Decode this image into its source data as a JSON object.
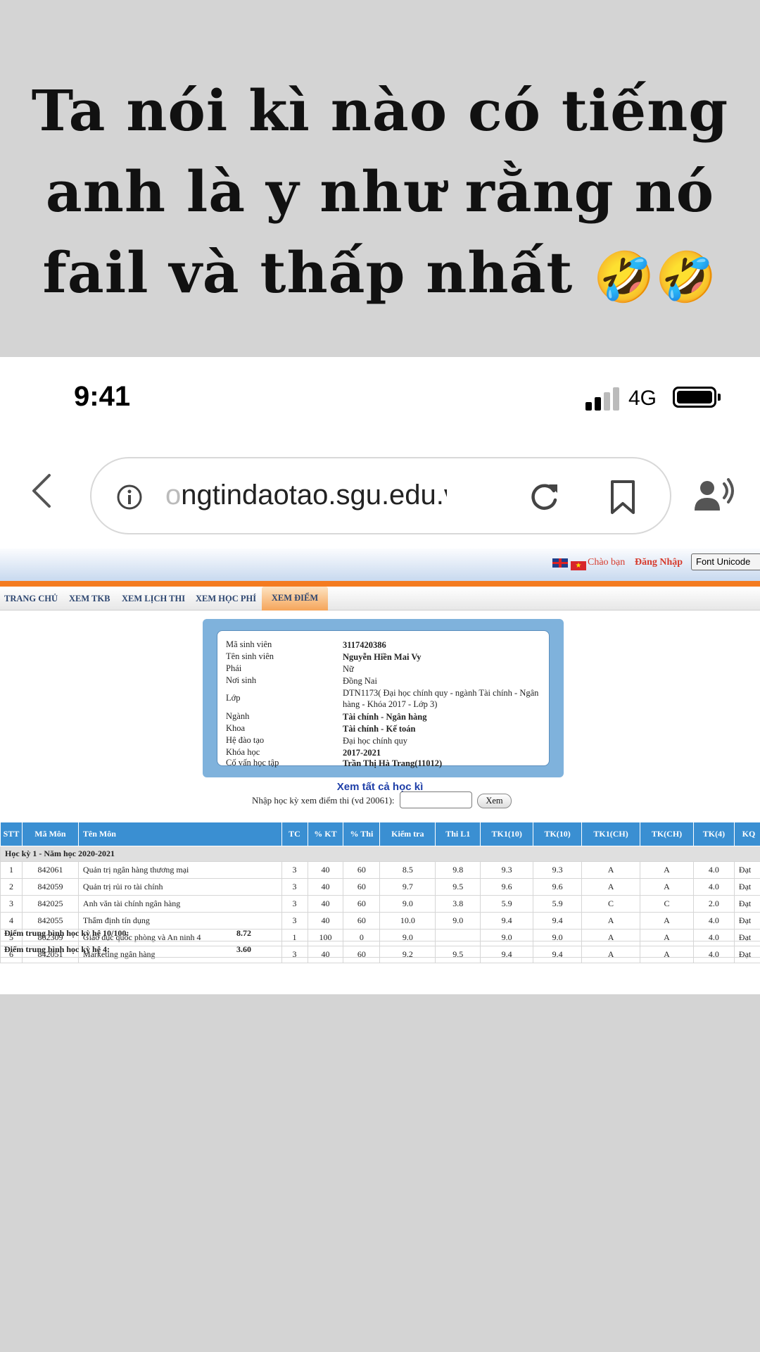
{
  "caption": {
    "line1": "Ta nói kì nào có tiếng",
    "line2": "anh là y như rằng nó",
    "line3": "fail và thấp nhất",
    "emoji": "🤣🤣"
  },
  "status_bar": {
    "time": "9:41",
    "network": "4G"
  },
  "browser": {
    "url_faded": "o",
    "url": "ngtindaotao.sgu.edu.vn",
    "icons": [
      "back-chevron-icon",
      "info-icon",
      "reload-icon",
      "bookmark-icon",
      "speaker-person-icon"
    ]
  },
  "site": {
    "header": {
      "greeting": "Chào bạn",
      "login": "Đăng Nhập",
      "font_select": "Font Unicode"
    },
    "nav": [
      "TRANG CHỦ",
      "XEM TKB",
      "XEM LỊCH THI",
      "XEM HỌC PHÍ",
      "XEM ĐIỂM"
    ],
    "student": {
      "labels": [
        "Mã sinh viên",
        "Tên sinh viên",
        "Phái",
        "Nơi sinh",
        "Lớp",
        "Ngành",
        "Khoa",
        "Hệ đào tạo",
        "Khóa học",
        "Cố vấn học tập"
      ],
      "values": [
        "3117420386",
        "Nguyễn Hiền Mai Vy",
        "Nữ",
        "Đồng Nai",
        "DTN1173( Đại học chính quy - ngành Tài chính - Ngân hàng - Khóa 2017 - Lớp 3)",
        "Tài chính - Ngân hàng",
        "Tài chính - Kế toán",
        "Đại học chính quy",
        "2017-2021",
        "Trần Thị Hà Trang(11012)"
      ]
    },
    "view_all": "Xem tất cả học kì",
    "term_input_label": "Nhập học kỳ xem điểm thi (vd 20061):",
    "term_input_value": "",
    "view_button": "Xem",
    "table": {
      "headers": [
        "STT",
        "Mã Môn",
        "Tên Môn",
        "TC",
        "% KT",
        "% Thi",
        "Kiểm tra",
        "Thi L1",
        "TK1(10)",
        "TK(10)",
        "TK1(CH)",
        "TK(CH)",
        "TK(4)",
        "KQ"
      ],
      "term_label": "Học kỳ 1 - Năm học 2020-2021",
      "rows": [
        [
          "1",
          "842061",
          "Quản trị ngân hàng thương mại",
          "3",
          "40",
          "60",
          "8.5",
          "9.8",
          "9.3",
          "9.3",
          "A",
          "A",
          "4.0",
          "Đạt"
        ],
        [
          "2",
          "842059",
          "Quản trị rủi ro tài chính",
          "3",
          "40",
          "60",
          "9.7",
          "9.5",
          "9.6",
          "9.6",
          "A",
          "A",
          "4.0",
          "Đạt"
        ],
        [
          "3",
          "842025",
          "Anh văn tài chính ngân hàng",
          "3",
          "40",
          "60",
          "9.0",
          "3.8",
          "5.9",
          "5.9",
          "C",
          "C",
          "2.0",
          "Đạt"
        ],
        [
          "4",
          "842055",
          "Thẩm định tín dụng",
          "3",
          "40",
          "60",
          "10.0",
          "9.0",
          "9.4",
          "9.4",
          "A",
          "A",
          "4.0",
          "Đạt"
        ],
        [
          "5",
          "862309",
          "Giáo dục quốc phòng và An ninh 4",
          "1",
          "100",
          "0",
          "9.0",
          "",
          "9.0",
          "9.0",
          "A",
          "A",
          "4.0",
          "Đạt"
        ],
        [
          "6",
          "842051",
          "Marketing ngân hàng",
          "3",
          "40",
          "60",
          "9.2",
          "9.5",
          "9.4",
          "9.4",
          "A",
          "A",
          "4.0",
          "Đạt"
        ]
      ]
    },
    "averages": [
      {
        "label": "Điểm trung bình học kỳ hệ 10/100:",
        "value": "8.72"
      },
      {
        "label": "Điểm trung bình học kỳ hệ 4:",
        "value": "3.60"
      }
    ]
  }
}
